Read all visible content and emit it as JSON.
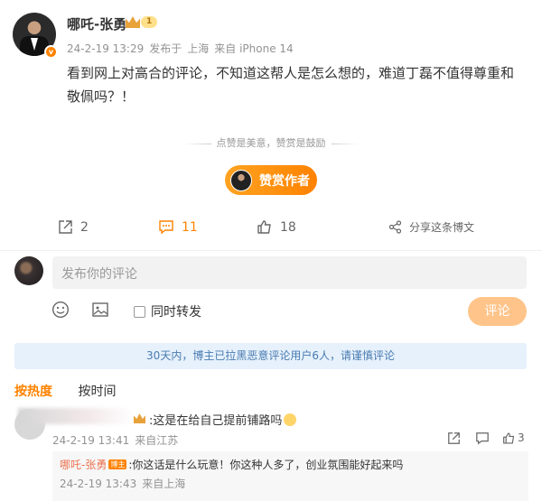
{
  "post": {
    "author": "哪吒-张勇",
    "level": "1",
    "date": "24-2-19 13:29",
    "source_prefix": "发布于",
    "location": "上海",
    "device": "来自 iPhone 14",
    "text": "看到网上对高合的评论，不知道这帮人是怎么想的，难道丁磊不值得尊重和敬佩吗？！"
  },
  "reward": {
    "hint": "点赞是美意，赞赏是鼓励",
    "button_label": "赞赏作者"
  },
  "actions": {
    "forward_count": "2",
    "comment_count": "11",
    "like_count": "18",
    "share_label": "分享这条博文"
  },
  "composer": {
    "placeholder": "发布你的评论",
    "forward_label": "同时转发",
    "submit_label": "评论"
  },
  "notice": "30天内，博主已拉黑恶意评论用户6人，请谨慎评论",
  "sort": {
    "hot": "按热度",
    "time": "按时间"
  },
  "comments": [
    {
      "text": ":这是在给自己提前铺路吗",
      "date": "24-2-19 13:41",
      "location": "来自江苏",
      "like_count": "3",
      "reply": {
        "author": "哪吒-张勇",
        "tag": "博主",
        "text": ":你这话是什么玩意！你这种人多了，创业氛围能好起来吗",
        "date": "24-2-19 13:43",
        "location": "来自上海"
      }
    }
  ],
  "colors": {
    "accent": "#ff8200",
    "reply_name": "#eb7350",
    "notice_bg": "#e6f1fc",
    "notice_text": "#4a7bb0"
  }
}
